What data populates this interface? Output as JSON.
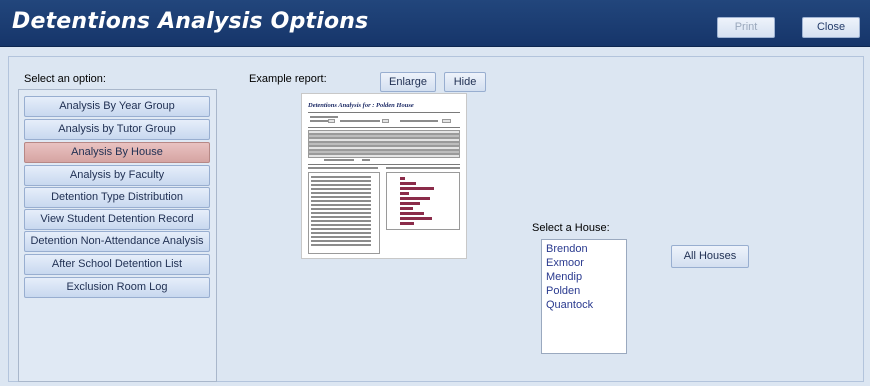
{
  "window": {
    "title": "Detentions Analysis Options",
    "print_label": "Print",
    "close_label": "Close"
  },
  "options": {
    "label": "Select an option:",
    "items": [
      "Analysis By Year Group",
      "Analysis by Tutor Group",
      "Analysis By House",
      "Analysis by Faculty",
      "Detention Type Distribution",
      "View Student Detention Record",
      "Detention Non-Attendance Analysis",
      "After School Detention List",
      "Exclusion Room Log"
    ],
    "selected": "Analysis By House"
  },
  "example": {
    "label": "Example report:",
    "enlarge_label": "Enlarge",
    "hide_label": "Hide",
    "report_title": "Detentions Analysis for : Polden House"
  },
  "house": {
    "label": "Select a House:",
    "items": [
      "Brendon",
      "Exmoor",
      "Mendip",
      "Polden",
      "Quantock"
    ],
    "all_label": "All Houses"
  },
  "colors": {
    "titlebar": "#1f3f74",
    "background": "#dce6f2",
    "selected_option": "#d9aaa8",
    "report_bar": "#8b2c4a"
  }
}
